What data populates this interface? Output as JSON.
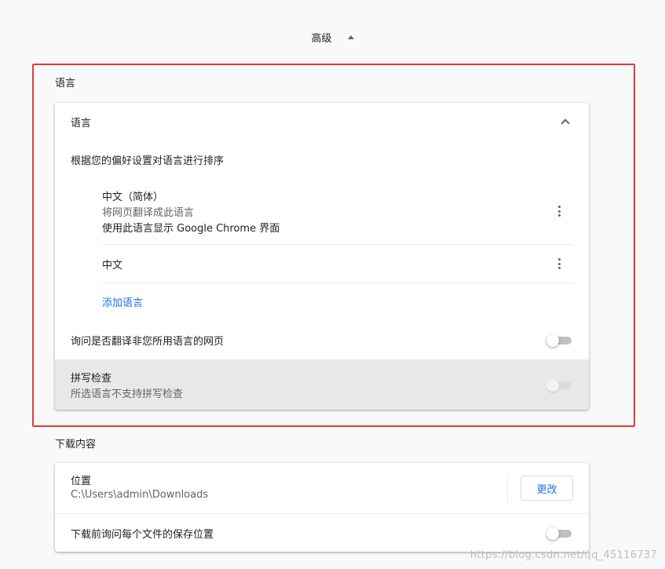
{
  "advanced": {
    "label": "高级"
  },
  "language_section": {
    "title": "语言",
    "card": {
      "header": "语言",
      "order_hint": "根据您的偏好设置对语言进行排序",
      "languages": [
        {
          "name": "中文（简体）",
          "line2": "将网页翻译成此语言",
          "line3": "使用此语言显示 Google Chrome 界面"
        },
        {
          "name": "中文"
        }
      ],
      "add_language": "添加语言",
      "offer_translate": "询问是否翻译非您所用语言的网页",
      "spellcheck": {
        "title": "拼写检查",
        "subtitle": "所选语言不支持拼写检查"
      }
    }
  },
  "downloads_section": {
    "title": "下载内容",
    "location": {
      "label": "位置",
      "path": "C:\\Users\\admin\\Downloads",
      "change_button": "更改"
    },
    "ask_where": "下载前询问每个文件的保存位置"
  },
  "watermark": "https://blog.csdn.net/qq_45116737",
  "colors": {
    "accent": "#1a73e8",
    "highlight": "#e53935",
    "background": "#f8f9fa"
  }
}
